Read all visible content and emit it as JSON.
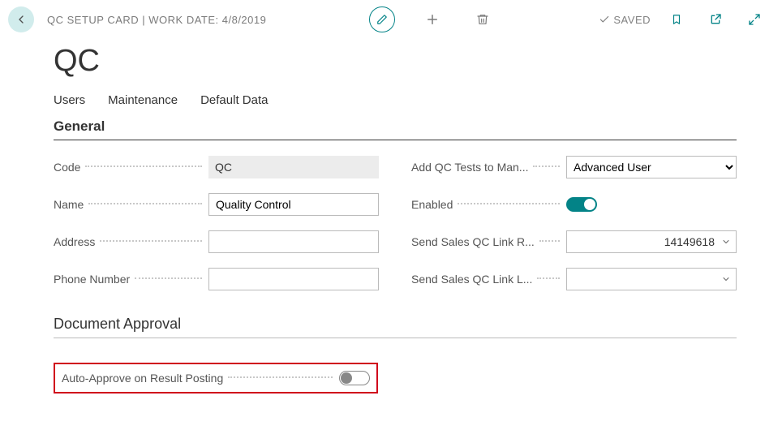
{
  "header": {
    "breadcrumb": "QC SETUP CARD | WORK DATE: 4/8/2019",
    "saved_label": "SAVED"
  },
  "page": {
    "title": "QC"
  },
  "tabs": {
    "users": "Users",
    "maintenance": "Maintenance",
    "default_data": "Default Data"
  },
  "sections": {
    "general": "General",
    "document_approval": "Document Approval"
  },
  "general": {
    "left": {
      "code_label": "Code",
      "code_value": "QC",
      "name_label": "Name",
      "name_value": "Quality Control",
      "address_label": "Address",
      "address_value": "",
      "phone_label": "Phone Number",
      "phone_value": ""
    },
    "right": {
      "add_qc_label": "Add QC Tests to Man...",
      "add_qc_value": "Advanced User",
      "enabled_label": "Enabled",
      "enabled_value": true,
      "send_sales_r_label": "Send Sales QC Link R...",
      "send_sales_r_value": "14149618",
      "send_sales_l_label": "Send Sales QC Link L...",
      "send_sales_l_value": ""
    }
  },
  "document_approval": {
    "auto_approve_label": "Auto-Approve on Result Posting",
    "auto_approve_value": false
  }
}
